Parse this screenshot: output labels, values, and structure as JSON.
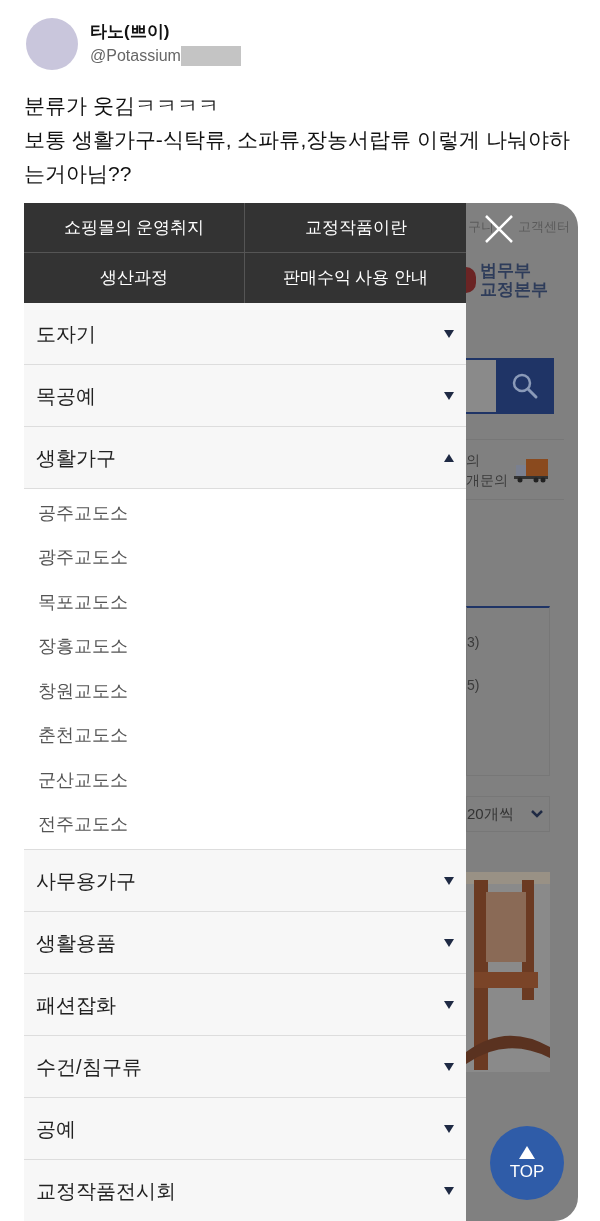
{
  "tweet": {
    "display_name": "타노(쁘이)",
    "handle": "@Potassium",
    "text_lines": [
      "분류가 웃김ㅋㅋㅋㅋ",
      "보통 생활가구-식탁류, 소파류,장농서랍류 이렇게 나눠야하",
      "는거아님??"
    ]
  },
  "menu": {
    "top_links": [
      {
        "label": "쇼핑몰의 운영취지"
      },
      {
        "label": "교정작품이란"
      },
      {
        "label": "생산과정"
      },
      {
        "label": "판매수익 사용 안내"
      }
    ],
    "categories": [
      {
        "label": "도자기",
        "expanded": false
      },
      {
        "label": "목공예",
        "expanded": false
      },
      {
        "label": "생활가구",
        "expanded": true,
        "children": [
          {
            "label": "공주교도소"
          },
          {
            "label": "광주교도소"
          },
          {
            "label": "목포교도소"
          },
          {
            "label": "장흥교도소"
          },
          {
            "label": "창원교도소"
          },
          {
            "label": "춘천교도소"
          },
          {
            "label": "군산교도소"
          },
          {
            "label": "전주교도소"
          }
        ]
      },
      {
        "label": "사무용가구",
        "expanded": false
      },
      {
        "label": "생활용품",
        "expanded": false
      },
      {
        "label": "패션잡화",
        "expanded": false
      },
      {
        "label": "수건/침구류",
        "expanded": false
      },
      {
        "label": "공예",
        "expanded": false
      },
      {
        "label": "교정작품전시회",
        "expanded": false
      }
    ]
  },
  "background_page": {
    "top_links": [
      "구니",
      "고객센터"
    ],
    "logo_lines": [
      "법무부",
      "교정본부"
    ],
    "notice_lines": [
      "의",
      "개문의"
    ],
    "counts": [
      "3)",
      "5)"
    ],
    "page_size": "20개씩",
    "top_button": "TOP"
  }
}
